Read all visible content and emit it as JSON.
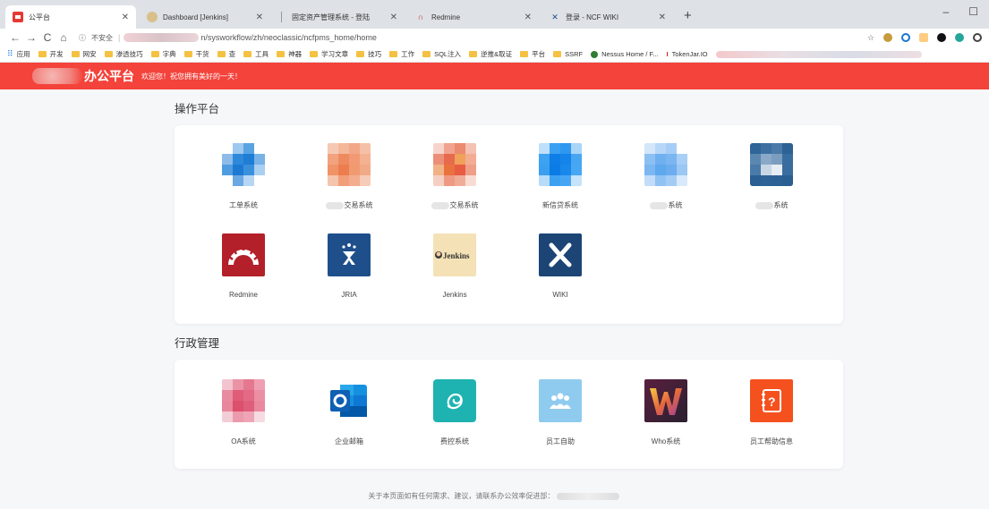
{
  "browser": {
    "tabs": [
      {
        "title": "公平台",
        "active": true,
        "icon": "red-app-icon"
      },
      {
        "title": "Dashboard [Jenkins]",
        "active": false,
        "icon": "jenkins-icon"
      },
      {
        "title": "固定资产管理系统 - 登陆",
        "active": false,
        "icon": "blank-page-icon"
      },
      {
        "title": "Redmine",
        "active": false,
        "icon": "redmine-icon"
      },
      {
        "title": "登录 - NCF WIKI",
        "active": false,
        "icon": "confluence-icon"
      }
    ],
    "new_tab": "+",
    "window_controls": [
      "–",
      "☐"
    ],
    "security_label": "不安全",
    "url": "n/sysworkflow/zh/neoclassic/ncfpms_home/home",
    "bookmarks": [
      "应用",
      "开发",
      "网安",
      "渗透技巧",
      "字典",
      "干货",
      "查",
      "工具",
      "神器",
      "学习文章",
      "技巧",
      "工作",
      "SQL注入",
      "逆推&取证",
      "平台",
      "SSRF",
      "Nessus Home / F...",
      "TokenJar.IO"
    ]
  },
  "header": {
    "title": "办公平台",
    "welcome": "欢迎您！祝您拥有美好的一天！",
    "accent_color": "#f3433b"
  },
  "sections": {
    "ops": {
      "title": "操作平台",
      "apps": [
        {
          "label": "工单系统",
          "icon": "ticket-system-icon"
        },
        {
          "label": "交易系统",
          "icon": "trade-system-a-icon"
        },
        {
          "label": "交易系统",
          "icon": "trade-system-b-icon"
        },
        {
          "label": "新信贷系统",
          "icon": "credit-system-icon"
        },
        {
          "label": "系统",
          "icon": "system-a-icon"
        },
        {
          "label": "系统",
          "icon": "system-b-icon"
        },
        {
          "label": "Redmine",
          "icon": "redmine-icon"
        },
        {
          "label": "JRIA",
          "icon": "jira-icon"
        },
        {
          "label": "Jenkins",
          "icon": "jenkins-icon"
        },
        {
          "label": "WIKI",
          "icon": "confluence-icon"
        }
      ]
    },
    "admin": {
      "title": "行政管理",
      "apps": [
        {
          "label": "OA系统",
          "icon": "oa-system-icon"
        },
        {
          "label": "企业邮箱",
          "icon": "outlook-icon"
        },
        {
          "label": "费控系统",
          "icon": "expense-control-icon"
        },
        {
          "label": "员工自助",
          "icon": "employee-self-service-icon"
        },
        {
          "label": "Who系统",
          "icon": "who-system-icon"
        },
        {
          "label": "员工帮助信息",
          "icon": "help-info-icon"
        }
      ]
    }
  },
  "footer": {
    "text": "关于本页面如有任何需求、建议，请联系办公效率促进部："
  }
}
